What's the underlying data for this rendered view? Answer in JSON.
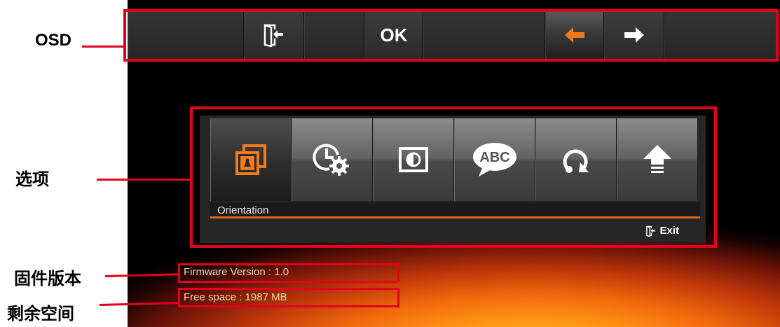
{
  "osd": {
    "ok_label": "OK"
  },
  "panel": {
    "tiles": [
      {
        "icon": "orientation-icon"
      },
      {
        "icon": "clock-settings-icon"
      },
      {
        "icon": "contrast-icon"
      },
      {
        "icon": "language-bubble-icon",
        "text": "ABC"
      },
      {
        "icon": "reset-icon"
      },
      {
        "icon": "upgrade-arrow-icon"
      }
    ],
    "selected_label": "Orientation",
    "exit_label": "Exit"
  },
  "info": {
    "firmware": "Firmware Version : 1.0",
    "free_space": "Free space : 1987 MB"
  },
  "annotations": {
    "osd": "OSD",
    "options": "选项",
    "firmware": "固件版本",
    "free_space": "剩余空间"
  },
  "colors": {
    "highlight": "#e3001b",
    "accent_orange": "#f07a1c"
  }
}
